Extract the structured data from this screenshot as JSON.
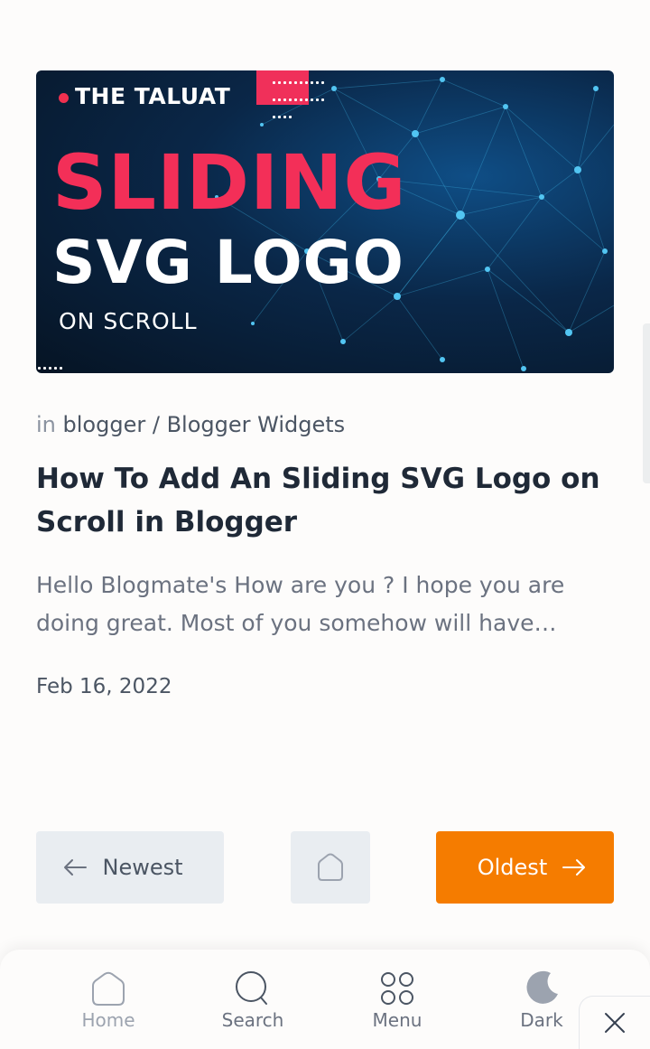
{
  "thumbnail": {
    "brand": "THE TALUAT",
    "title_line1": "SLIDING",
    "title_line2": "SVG LOGO",
    "title_line3": "ON SCROLL"
  },
  "post": {
    "meta_prefix": "in",
    "categories": "blogger / Blogger Widgets",
    "title": "How To Add An Sliding SVG Logo on Scroll in Blogger",
    "excerpt": "Hello Blogmate's How are you ? I hope you are doing great. Most of you somehow will have…",
    "date": "Feb 16, 2022"
  },
  "pager": {
    "newest_label": "Newest",
    "oldest_label": "Oldest"
  },
  "bottom_nav": {
    "items": [
      {
        "label": "Home",
        "icon": "home-icon"
      },
      {
        "label": "Search",
        "icon": "search-icon"
      },
      {
        "label": "Menu",
        "icon": "grid-icon"
      },
      {
        "label": "Dark",
        "icon": "moon-icon"
      }
    ],
    "close_icon": "close-icon"
  },
  "colors": {
    "accent": "#f57c00",
    "thumbnail_pink": "#f32f58",
    "text_dark": "#1f2937",
    "text_muted": "#6b7280"
  }
}
